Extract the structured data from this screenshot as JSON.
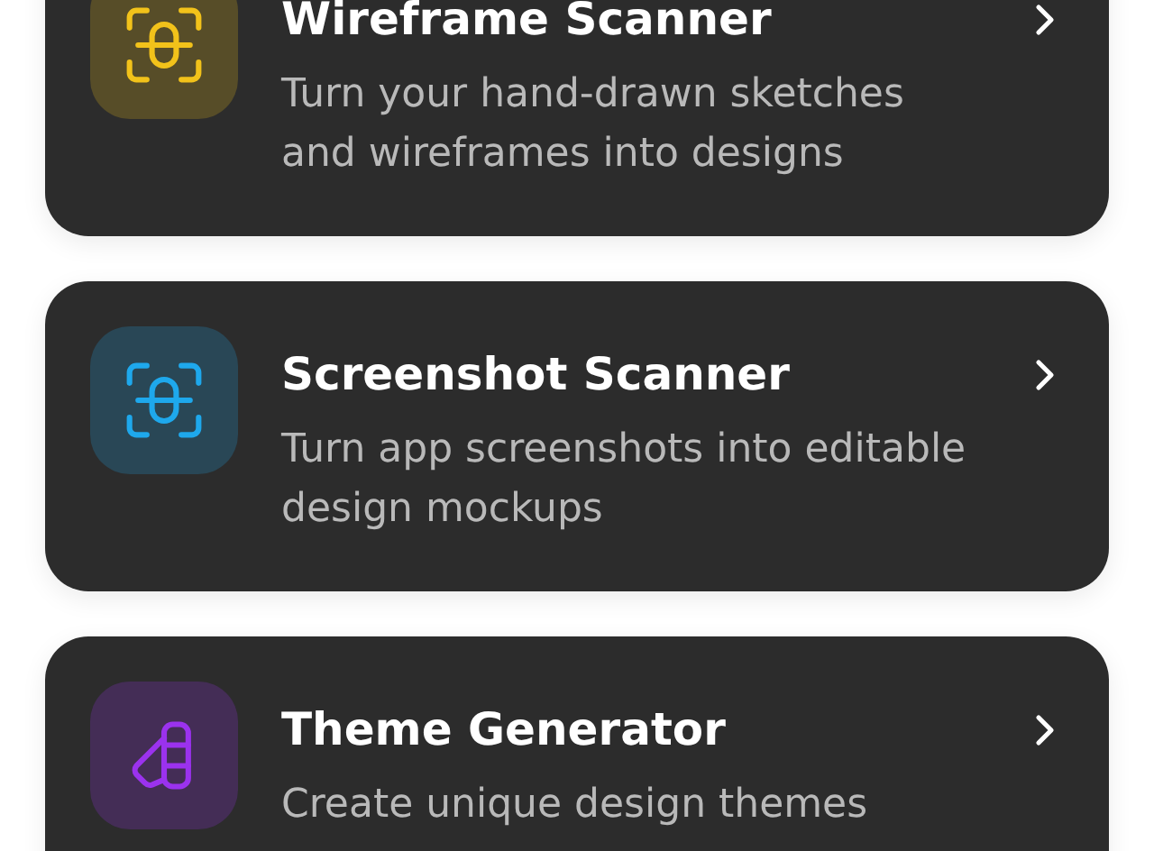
{
  "tools": [
    {
      "title": "Wireframe Scanner",
      "description": "Turn your hand-drawn sketches and wireframes into designs",
      "kind": "scan",
      "color": "#f2c21a"
    },
    {
      "title": "Screenshot Scanner",
      "description": "Turn app screenshots into editable design mockups",
      "kind": "scan",
      "color": "#1ea8ec"
    },
    {
      "title": "Theme Generator",
      "description": "Create unique design themes",
      "kind": "swatch",
      "color": "#9b32ee"
    }
  ]
}
